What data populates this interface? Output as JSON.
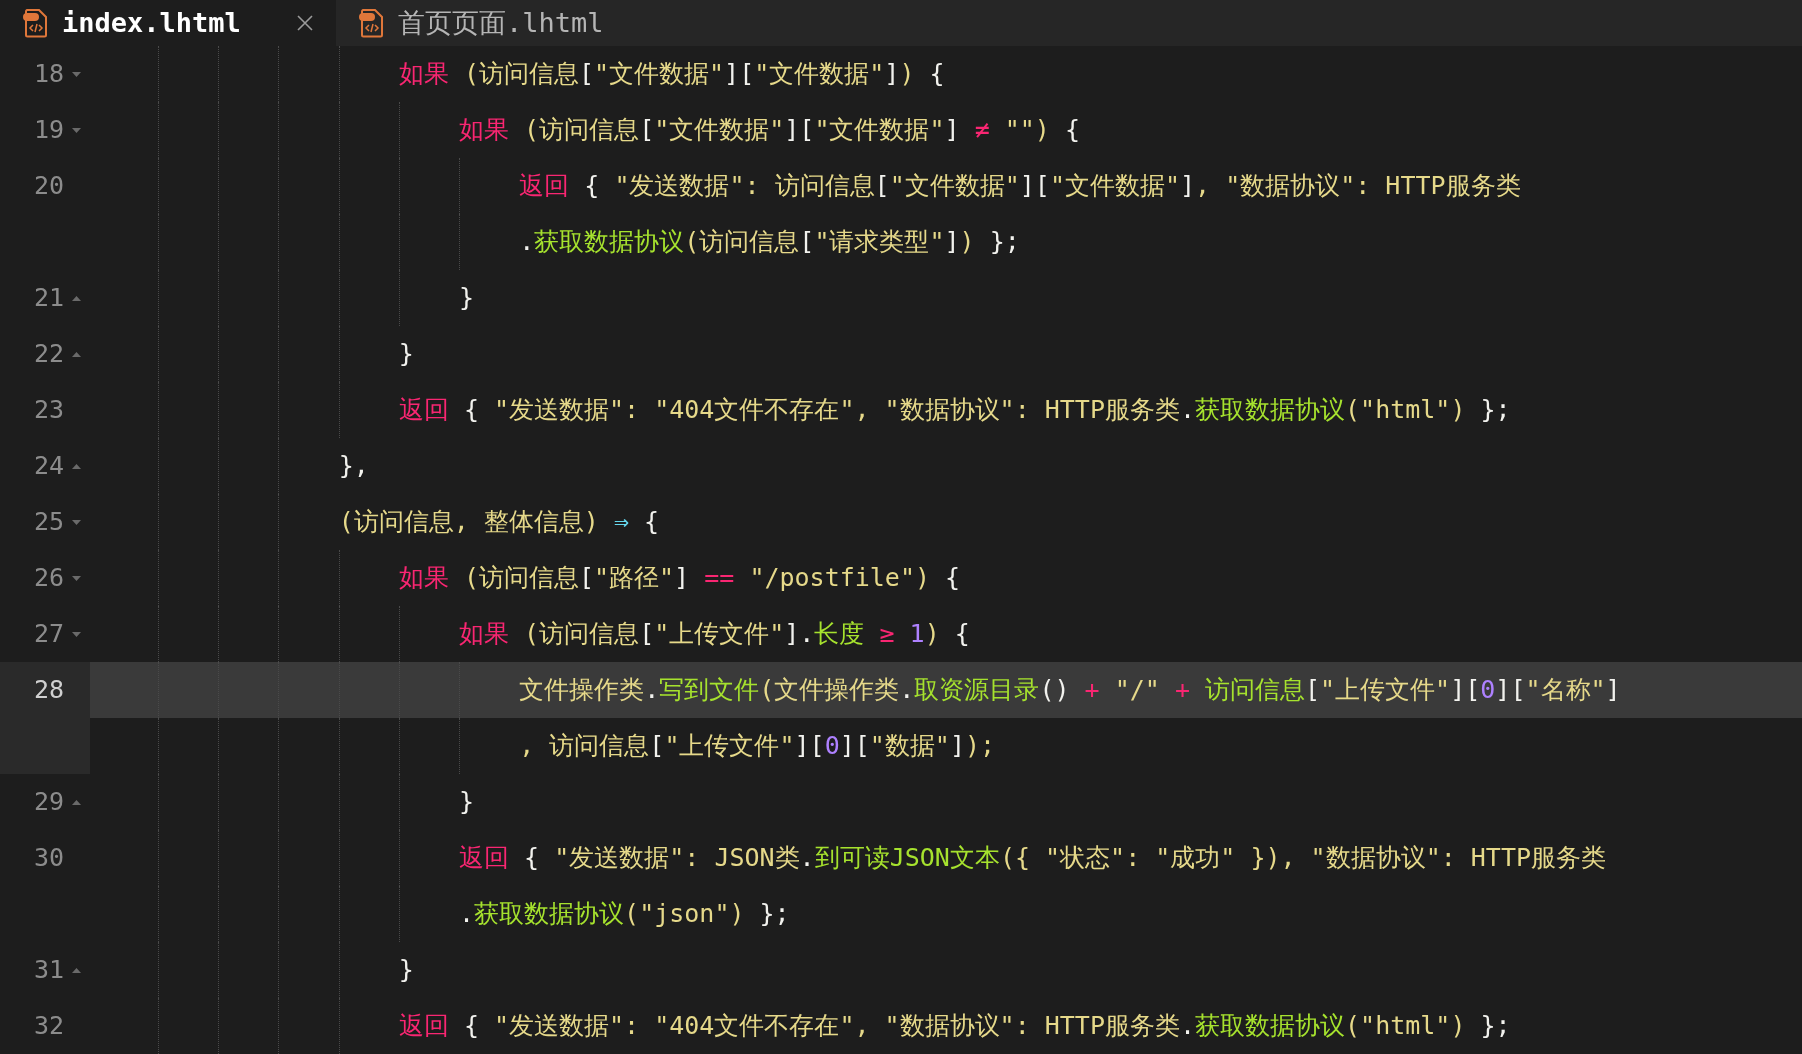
{
  "tabs": [
    {
      "label": "index.lhtml",
      "selected": true,
      "closable": true
    },
    {
      "label": "首页页面.lhtml",
      "selected": false,
      "closable": false
    }
  ],
  "editor": {
    "lines": [
      {
        "number": "18",
        "kind": "block-start",
        "current": false,
        "segments": [
          {
            "kind": "kw",
            "text": "如果"
          },
          {
            "kind": "text",
            "text": " (访问信息"
          },
          {
            "kind": "punct",
            "text": "["
          },
          {
            "kind": "text",
            "text": "\"文件数据\""
          },
          {
            "kind": "punct",
            "text": "]["
          },
          {
            "kind": "text",
            "text": "\"文件数据\""
          },
          {
            "kind": "punct",
            "text": "]"
          },
          {
            "kind": "text",
            "text": ")"
          },
          {
            "kind": "punct",
            "text": " {"
          }
        ]
      },
      {
        "number": "19",
        "kind": "block-start",
        "current": false,
        "segments": [
          {
            "kind": "kw",
            "text": "如果"
          },
          {
            "kind": "text",
            "text": " (访问信息"
          },
          {
            "kind": "punct",
            "text": "["
          },
          {
            "kind": "text",
            "text": "\"文件数据\""
          },
          {
            "kind": "punct",
            "text": "]["
          },
          {
            "kind": "text",
            "text": "\"文件数据\""
          },
          {
            "kind": "punct",
            "text": "]"
          },
          {
            "kind": "op",
            "text": " ≠ "
          },
          {
            "kind": "text",
            "text": "\"\")"
          },
          {
            "kind": "punct",
            "text": " {"
          }
        ]
      },
      {
        "number": "20",
        "kind": "plain",
        "current": false,
        "segments": [
          {
            "kind": "kw",
            "text": "返回"
          },
          {
            "kind": "punct",
            "text": " { "
          },
          {
            "kind": "text",
            "text": "\"发送数据\": 访问信息"
          },
          {
            "kind": "punct",
            "text": "["
          },
          {
            "kind": "text",
            "text": "\"文件数据\""
          },
          {
            "kind": "punct",
            "text": "]["
          },
          {
            "kind": "text",
            "text": "\"文件数据\""
          },
          {
            "kind": "punct",
            "text": "]"
          },
          {
            "kind": "text",
            "text": ", \"数据协议\": HTTP服务类"
          }
        ],
        "continuation": [
          {
            "kind": "punct",
            "text": "."
          },
          {
            "kind": "fn",
            "text": "获取数据协议"
          },
          {
            "kind": "text",
            "text": "(访问信息"
          },
          {
            "kind": "punct",
            "text": "["
          },
          {
            "kind": "text",
            "text": "\"请求类型\""
          },
          {
            "kind": "punct",
            "text": "]"
          },
          {
            "kind": "text",
            "text": ")"
          },
          {
            "kind": "punct",
            "text": " };"
          }
        ]
      },
      {
        "number": "21",
        "kind": "block-end",
        "current": false,
        "segments": [
          {
            "kind": "punct",
            "text": "}"
          }
        ]
      },
      {
        "number": "22",
        "kind": "block-end",
        "current": false,
        "segments": [
          {
            "kind": "punct",
            "text": "}"
          }
        ]
      },
      {
        "number": "23",
        "kind": "plain",
        "current": false,
        "segments": [
          {
            "kind": "kw",
            "text": "返回"
          },
          {
            "kind": "punct",
            "text": " { "
          },
          {
            "kind": "text",
            "text": "\"发送数据\": \"404文件不存在\", \"数据协议\": HTTP服务类"
          },
          {
            "kind": "punct",
            "text": "."
          },
          {
            "kind": "fn",
            "text": "获取数据协议"
          },
          {
            "kind": "text",
            "text": "(\"html\")"
          },
          {
            "kind": "punct",
            "text": " };"
          }
        ]
      },
      {
        "number": "24",
        "kind": "block-end",
        "current": false,
        "segments": [
          {
            "kind": "punct",
            "text": "},"
          }
        ]
      },
      {
        "number": "25",
        "kind": "block-start",
        "current": false,
        "segments": [
          {
            "kind": "text",
            "text": "(访问信息, 整体信息) "
          },
          {
            "kind": "arrow",
            "text": "⇒"
          },
          {
            "kind": "punct",
            "text": " {"
          }
        ]
      },
      {
        "number": "26",
        "kind": "block-start",
        "current": false,
        "segments": [
          {
            "kind": "kw",
            "text": "如果"
          },
          {
            "kind": "text",
            "text": " (访问信息"
          },
          {
            "kind": "punct",
            "text": "["
          },
          {
            "kind": "text",
            "text": "\"路径\""
          },
          {
            "kind": "punct",
            "text": "]"
          },
          {
            "kind": "op",
            "text": " == "
          },
          {
            "kind": "text",
            "text": "\"/postfile\")"
          },
          {
            "kind": "punct",
            "text": " {"
          }
        ]
      },
      {
        "number": "27",
        "kind": "block-start",
        "current": false,
        "segments": [
          {
            "kind": "kw",
            "text": "如果"
          },
          {
            "kind": "text",
            "text": " (访问信息"
          },
          {
            "kind": "punct",
            "text": "["
          },
          {
            "kind": "text",
            "text": "\"上传文件\""
          },
          {
            "kind": "punct",
            "text": "]."
          },
          {
            "kind": "fn",
            "text": "长度"
          },
          {
            "kind": "op",
            "text": " ≥ "
          },
          {
            "kind": "num",
            "text": "1"
          },
          {
            "kind": "text",
            "text": ")"
          },
          {
            "kind": "punct",
            "text": " {"
          }
        ]
      },
      {
        "number": "28",
        "kind": "plain",
        "current": true,
        "segments": [
          {
            "kind": "text",
            "text": "文件操作类"
          },
          {
            "kind": "punct",
            "text": "."
          },
          {
            "kind": "fn",
            "text": "写到文件"
          },
          {
            "kind": "text",
            "text": "(文件操作类"
          },
          {
            "kind": "punct",
            "text": "."
          },
          {
            "kind": "fn",
            "text": "取资源目录"
          },
          {
            "kind": "punct",
            "text": "()"
          },
          {
            "kind": "op",
            "text": " + "
          },
          {
            "kind": "text",
            "text": "\"/\""
          },
          {
            "kind": "op",
            "text": " + "
          },
          {
            "kind": "fn",
            "text": "访问信息"
          },
          {
            "kind": "punct",
            "text": "["
          },
          {
            "kind": "text",
            "text": "\"上传文件\""
          },
          {
            "kind": "punct",
            "text": "]["
          },
          {
            "kind": "num",
            "text": "0"
          },
          {
            "kind": "punct",
            "text": "]["
          },
          {
            "kind": "text",
            "text": "\"名称\""
          },
          {
            "kind": "punct",
            "text": "]"
          }
        ],
        "continuation": [
          {
            "kind": "text",
            "text": ", 访问信息"
          },
          {
            "kind": "punct",
            "text": "["
          },
          {
            "kind": "text",
            "text": "\"上传文件\""
          },
          {
            "kind": "punct",
            "text": "]["
          },
          {
            "kind": "num",
            "text": "0"
          },
          {
            "kind": "punct",
            "text": "]["
          },
          {
            "kind": "text",
            "text": "\"数据\""
          },
          {
            "kind": "punct",
            "text": "]"
          },
          {
            "kind": "text",
            "text": ");"
          }
        ]
      },
      {
        "number": "29",
        "kind": "block-end",
        "current": false,
        "segments": [
          {
            "kind": "punct",
            "text": "}"
          }
        ]
      },
      {
        "number": "30",
        "kind": "plain",
        "current": false,
        "segments": [
          {
            "kind": "kw",
            "text": "返回"
          },
          {
            "kind": "punct",
            "text": " { "
          },
          {
            "kind": "text",
            "text": "\"发送数据\": JSON类"
          },
          {
            "kind": "punct",
            "text": "."
          },
          {
            "kind": "fn",
            "text": "到可读JSON文本"
          },
          {
            "kind": "text",
            "text": "({ \"状态\": \"成功\" }), \"数据协议\": HTTP服务类"
          }
        ],
        "continuation": [
          {
            "kind": "punct",
            "text": "."
          },
          {
            "kind": "fn",
            "text": "获取数据协议"
          },
          {
            "kind": "text",
            "text": "(\"json\")"
          },
          {
            "kind": "punct",
            "text": " };"
          }
        ]
      },
      {
        "number": "31",
        "kind": "block-end",
        "current": false,
        "segments": [
          {
            "kind": "punct",
            "text": "}"
          }
        ]
      },
      {
        "number": "32",
        "kind": "plain",
        "current": false,
        "segments": [
          {
            "kind": "kw",
            "text": "返回"
          },
          {
            "kind": "punct",
            "text": " { "
          },
          {
            "kind": "text",
            "text": "\"发送数据\": \"404文件不存在\", \"数据协议\": HTTP服务类"
          },
          {
            "kind": "punct",
            "text": "."
          },
          {
            "kind": "fn",
            "text": "获取数据协议"
          },
          {
            "kind": "text",
            "text": "(\"html\")"
          },
          {
            "kind": "punct",
            "text": " };"
          }
        ]
      }
    ]
  }
}
